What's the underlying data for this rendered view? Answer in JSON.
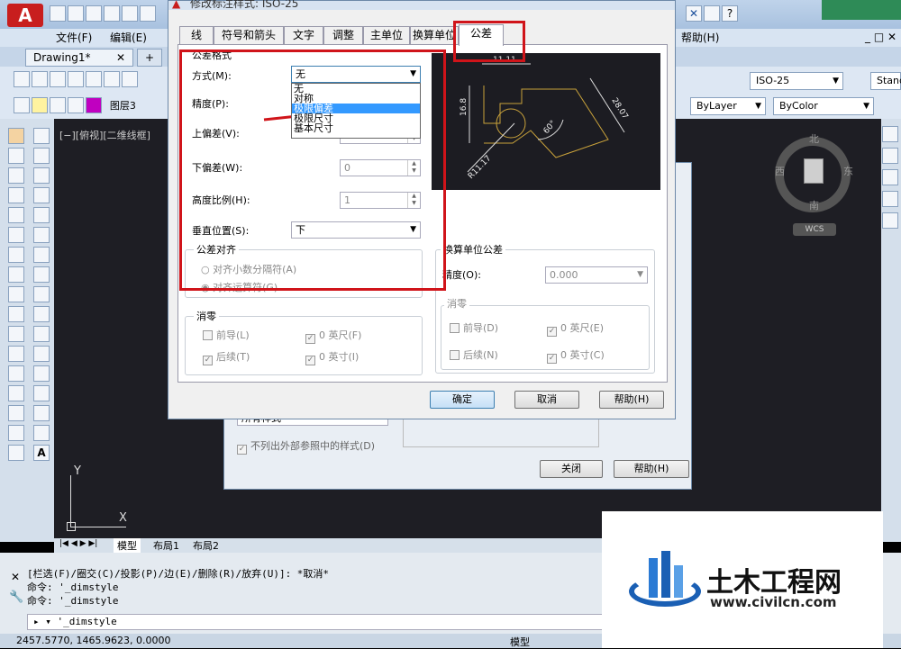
{
  "menu": {
    "file": "文件(F)",
    "edit": "编辑(E)",
    "help": "帮助(H)"
  },
  "document": {
    "tab": "Drawing1*"
  },
  "toolbar": {
    "layer": "图层3",
    "dimstyle": "ISO-25",
    "bylayer": "ByLayer",
    "bycolor": "ByColor",
    "standard": "Stanc"
  },
  "viewport": {
    "label": "[−][俯视][二维线框]",
    "compass_n": "北",
    "compass_s": "南",
    "compass_e": "东",
    "compass_w": "西",
    "wcs": "WCS",
    "ucs_x": "X",
    "ucs_y": "Y"
  },
  "layout_tabs": [
    "模型",
    "布局1",
    "布局2"
  ],
  "command": {
    "line1": "[栏选(F)/圈交(C)/投影(P)/边(E)/删除(R)/放弃(U)]: *取消*",
    "line2": "命令: '_dimstyle",
    "line3": "命令: '_dimstyle",
    "input": "'_dimstyle"
  },
  "status": {
    "coords": "2457.5770, 1465.9623, 0.0000",
    "model": "模型"
  },
  "back_dialog": {
    "list_item": "所有样式",
    "checkbox": "不列出外部参照中的样式(D)",
    "close": "关闭",
    "help": "帮助(H)"
  },
  "dialog": {
    "title": "修改标注样式: ISO-25",
    "tabs": [
      "线",
      "符号和箭头",
      "文字",
      "调整",
      "主单位",
      "换算单位",
      "公差"
    ],
    "active_tab": "公差",
    "section_format": "公差格式",
    "method_label": "方式(M):",
    "method_value": "无",
    "method_options": [
      "无",
      "对称",
      "极限偏差",
      "极限尺寸",
      "基本尺寸"
    ],
    "highlighted_option": "极限偏差",
    "precision_label": "精度(P):",
    "upper_label": "上偏差(V):",
    "lower_label": "下偏差(W):",
    "lower_value": "0",
    "height_label": "高度比例(H):",
    "height_value": "1",
    "vpos_label": "垂直位置(S):",
    "vpos_value": "下",
    "align_title": "公差对齐",
    "align_opt1": "对齐小数分隔符(A)",
    "align_opt2": "对齐运算符(G)",
    "zero_title": "消零",
    "lead": "前导(L)",
    "trail": "后续(T)",
    "feet": "0 英尺(F)",
    "inch": "0 英寸(I)",
    "alt_title": "换算单位公差",
    "alt_precision_label": "精度(O):",
    "alt_precision_value": "0.000",
    "alt_zero_title": "消零",
    "alt_lead": "前导(D)",
    "alt_trail": "后续(N)",
    "alt_feet": "0 英尺(E)",
    "alt_inch": "0 英寸(C)",
    "ok": "确定",
    "cancel": "取消",
    "help": "帮助(H)"
  },
  "preview": {
    "dim_top": "11.11",
    "dim_left": "16.8",
    "dim_right": "28.07",
    "angle": "60°",
    "radius": "R11.17"
  },
  "watermark": {
    "name": "土木工程网",
    "url": "www.civilcn.com"
  },
  "colors": {
    "accent": "#d0141a",
    "canvas": "#1e1e24",
    "preview_bg": "#1c1c22",
    "highlight": "#3399ff",
    "logo_blue": "#1a5fb4"
  }
}
